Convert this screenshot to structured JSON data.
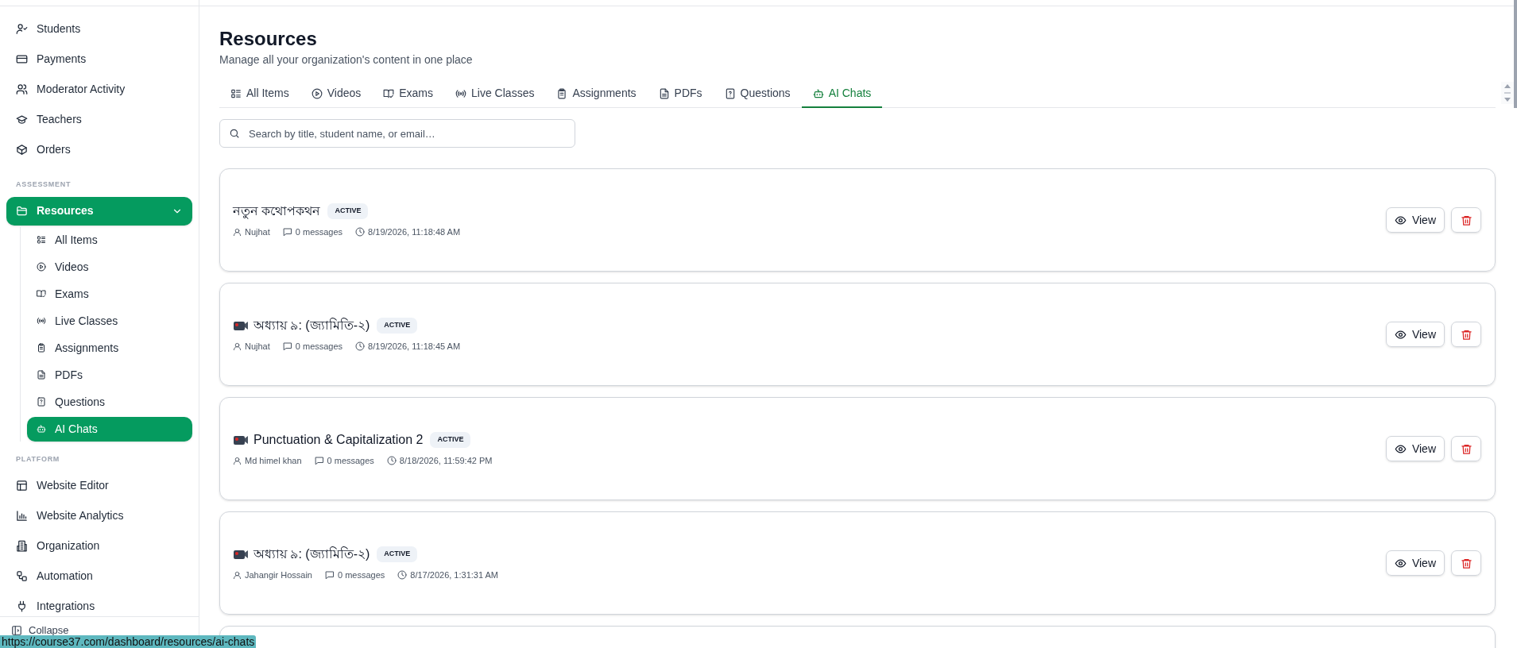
{
  "sidebar": {
    "items": [
      {
        "label": "Students",
        "selected": false
      },
      {
        "label": "Payments",
        "selected": false
      },
      {
        "label": "Moderator Activity",
        "selected": false
      },
      {
        "label": "Teachers",
        "selected": false
      },
      {
        "label": "Orders",
        "selected": false
      }
    ],
    "sections": [
      {
        "heading": "ASSESSMENT",
        "items": [
          {
            "label": "Resources",
            "selected": true,
            "expanded": true,
            "children": [
              {
                "label": "All Items",
                "selected": false
              },
              {
                "label": "Videos",
                "selected": false
              },
              {
                "label": "Exams",
                "selected": false
              },
              {
                "label": "Live Classes",
                "selected": false
              },
              {
                "label": "Assignments",
                "selected": false
              },
              {
                "label": "PDFs",
                "selected": false
              },
              {
                "label": "Questions",
                "selected": false
              },
              {
                "label": "AI Chats",
                "selected": true
              }
            ]
          }
        ]
      },
      {
        "heading": "PLATFORM",
        "items": [
          {
            "label": "Website Editor",
            "selected": false
          },
          {
            "label": "Website Analytics",
            "selected": false
          },
          {
            "label": "Organization",
            "selected": false
          },
          {
            "label": "Automation",
            "selected": false
          },
          {
            "label": "Integrations",
            "selected": false
          }
        ]
      }
    ],
    "collapse": "Collapse"
  },
  "header": {
    "title": "Resources",
    "subtitle": "Manage all your organization's content in one place"
  },
  "tabs": [
    {
      "label": "All Items",
      "selected": false
    },
    {
      "label": "Videos",
      "selected": false
    },
    {
      "label": "Exams",
      "selected": false
    },
    {
      "label": "Live Classes",
      "selected": false
    },
    {
      "label": "Assignments",
      "selected": false
    },
    {
      "label": "PDFs",
      "selected": false
    },
    {
      "label": "Questions",
      "selected": false
    },
    {
      "label": "AI Chats",
      "selected": true
    }
  ],
  "search": {
    "placeholder": "Search by title, student name, or email…"
  },
  "chats": [
    {
      "video": false,
      "title": "নতুন কথোপকথন",
      "status": "ACTIVE",
      "user": "Nujhat",
      "messages": "0 messages",
      "time": "8/19/2026, 11:18:48 AM",
      "view": "View"
    },
    {
      "video": true,
      "title": "অধ্যায় ৯: (জ্যামিতি-২)",
      "status": "ACTIVE",
      "user": "Nujhat",
      "messages": "0 messages",
      "time": "8/19/2026, 11:18:45 AM",
      "view": "View"
    },
    {
      "video": true,
      "title": "Punctuation & Capitalization 2",
      "status": "ACTIVE",
      "user": "Md himel khan",
      "messages": "0 messages",
      "time": "8/18/2026, 11:59:42 PM",
      "view": "View"
    },
    {
      "video": true,
      "title": "অধ্যায় ৯: (জ্যামিতি-২)",
      "status": "ACTIVE",
      "user": "Jahangir Hossain",
      "messages": "0 messages",
      "time": "8/17/2026, 1:31:31 AM",
      "view": "View"
    }
  ],
  "status_url": "https://course37.com/dashboard/resources/ai-chats"
}
